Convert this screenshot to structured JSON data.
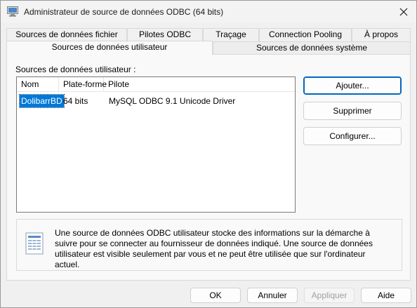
{
  "window": {
    "title": "Administrateur de source de données ODBC (64 bits)"
  },
  "tabs": {
    "row1": [
      {
        "label": "Sources de données fichier"
      },
      {
        "label": "Pilotes ODBC"
      },
      {
        "label": "Traçage"
      },
      {
        "label": "Connection Pooling"
      },
      {
        "label": "À propos"
      }
    ],
    "row2": [
      {
        "label": "Sources de données utilisateur",
        "active": true
      },
      {
        "label": "Sources de données système",
        "active": false
      }
    ]
  },
  "panel": {
    "section_label": "Sources de données utilisateur :",
    "columns": [
      "Nom",
      "Plate-forme",
      "Pilote"
    ],
    "rows": [
      {
        "name": "DolibarrBD",
        "platform": "64 bits",
        "driver": "MySQL ODBC 9.1 Unicode Driver",
        "selected": true
      }
    ],
    "buttons": {
      "add": "Ajouter...",
      "remove": "Supprimer",
      "configure": "Configurer..."
    },
    "info_text": "Une source de données ODBC utilisateur stocke des informations sur la démarche à suivre pour se connecter au fournisseur de données indiqué.   Une source de données utilisateur est visible seulement par vous et ne peut être utilisée que sur l'ordinateur actuel."
  },
  "footer": {
    "ok": "OK",
    "cancel": "Annuler",
    "apply": "Appliquer",
    "help": "Aide"
  },
  "colors": {
    "accent": "#0067c0",
    "selection": "#0078d7"
  },
  "icons": {
    "title": "odbc-window-icon",
    "close": "close-icon",
    "info": "datasource-document-icon"
  }
}
